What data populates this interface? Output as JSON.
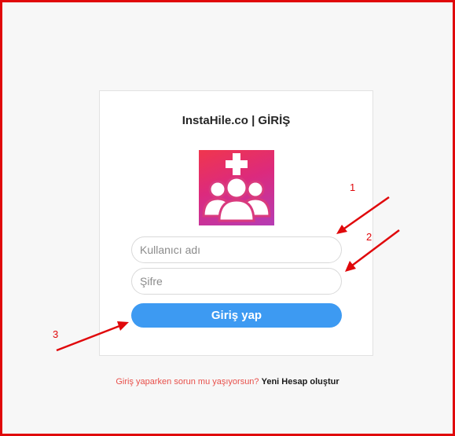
{
  "login": {
    "title": "InstaHile.co | GİRİŞ",
    "logo_icon": "group-plus-icon",
    "username_placeholder": "Kullanıcı adı",
    "password_placeholder": "Şifre",
    "submit_label": "Giriş yap"
  },
  "footer": {
    "question": "Giriş yaparken sorun mu yaşıyorsun?",
    "signup_link": "Yeni Hesap oluştur"
  },
  "annotations": {
    "step_1": "1",
    "step_2": "2",
    "step_3": "3"
  },
  "colors": {
    "accent_button": "#3d9af2",
    "annotation_red": "#e0080b",
    "logo_gradient_start": "#f0364d",
    "logo_gradient_end": "#b53cb4",
    "footer_question": "#e8504b"
  }
}
